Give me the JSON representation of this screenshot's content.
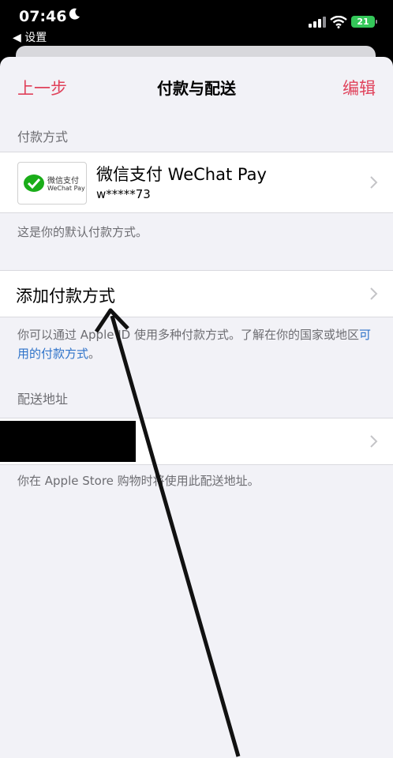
{
  "status_bar": {
    "time": "07:46",
    "back_app": "◀ 设置",
    "battery": "21"
  },
  "nav": {
    "back_label": "上一步",
    "title": "付款与配送",
    "edit_label": "编辑"
  },
  "payment": {
    "section_label": "付款方式",
    "method_title": "微信支付 WeChat Pay",
    "account": "w*****73",
    "logo_cn": "微信支付",
    "logo_en": "WeChat Pay",
    "default_note": "这是你的默认付款方式。",
    "add_label": "添加付款方式",
    "info_text_before_link": "你可以通过 Apple ID 使用多种付款方式。了解在你的国家或地区",
    "info_link": "可用的付款方式",
    "info_text_after_link": "。"
  },
  "shipping": {
    "section_label": "配送地址",
    "note": "你在 Apple Store 购物时将使用此配送地址。"
  },
  "colors": {
    "accent_red": "#e0425b",
    "link_blue": "#2f73c9",
    "background": "#f2f2f7"
  }
}
